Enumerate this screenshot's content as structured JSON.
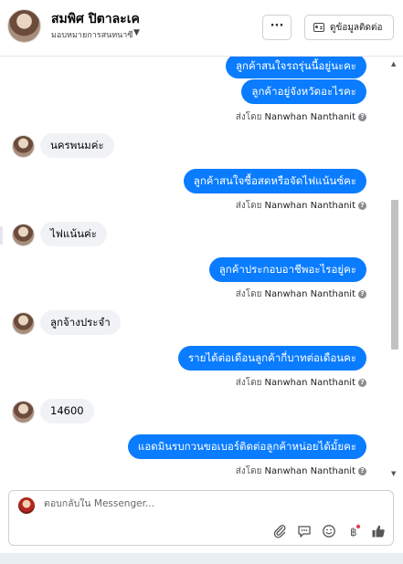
{
  "header": {
    "name": "สมพิศ ปิตาละเค",
    "assign_label": "มอบหมายการสนทนาซี",
    "more_label": "···",
    "contact_label": "ดูข้อมูลติดต่อ"
  },
  "messages": {
    "out1": "ลูกค้าสนใจรถรุ่นนี้อยู่นะคะ",
    "out2": "ลูกค้าอยู่จังหวัดอะไรคะ",
    "sent_by_1": "ส่งโดย",
    "agent_1": "Nanwhan Nanthanit",
    "in1": "นครพนมค่ะ",
    "out3": "ลูกค้าสนใจซื้อสดหรือจัดไฟแน้นซ์คะ",
    "sent_by_2": "ส่งโดย",
    "agent_2": "Nanwhan Nanthanit",
    "in2": "ไฟแน้นค่ะ",
    "out4": "ลูกค้าประกอบอาชีพอะไรอยู่คะ",
    "sent_by_3": "ส่งโดย",
    "agent_3": "Nanwhan Nanthanit",
    "in3": "ลูกจ้างประจำ",
    "out5": "รายได้ต่อเดือนลูกค้ากี่บาทต่อเดือนคะ",
    "sent_by_4": "ส่งโดย",
    "agent_4": "Nanwhan Nanthanit",
    "in4": "14600",
    "out6": "แอดมินรบกวนขอเบอร์ติดต่อลูกค้าหน่อยได้มั้ยคะ",
    "sent_by_5": "ส่งโดย",
    "agent_5": "Nanwhan Nanthanit"
  },
  "composer": {
    "placeholder": "ตอบกลับใน Messenger..."
  },
  "icons": {
    "attach": "paperclip-icon",
    "saved_replies": "speech-bubble-icon",
    "emoji": "emoji-icon",
    "payment": "baht-icon",
    "like": "thumbs-up-icon",
    "brand": "#0a7cff"
  }
}
